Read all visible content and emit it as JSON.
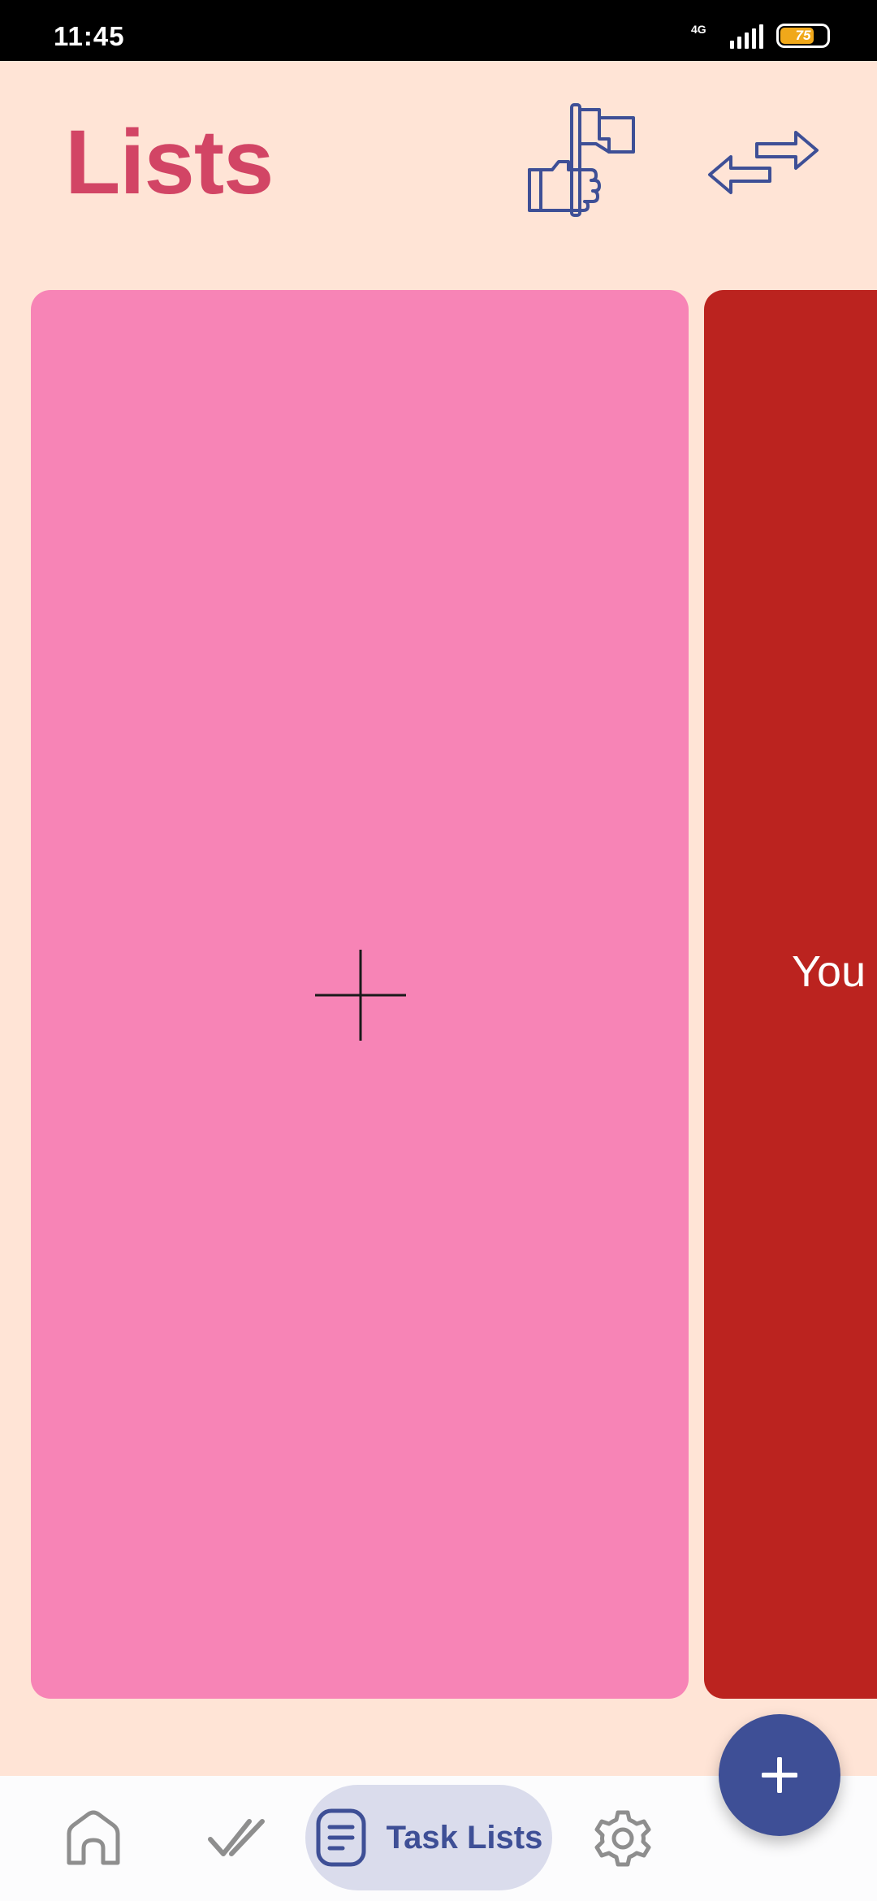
{
  "status_bar": {
    "time": "11:45",
    "network_type": "4G",
    "battery_level": "75",
    "battery_fraction": 0.75
  },
  "header": {
    "title": "Lists",
    "flag_icon": "hand-holding-flag-icon",
    "swap_icon": "swap-arrows-icon"
  },
  "cards": [
    {
      "type": "add",
      "icon": "plus-icon",
      "color": "#F784B6"
    },
    {
      "type": "list",
      "text": "You",
      "color": "#BB231F"
    }
  ],
  "bottom_nav": {
    "items": [
      {
        "icon": "home-icon",
        "label": "",
        "active": false
      },
      {
        "icon": "double-check-icon",
        "label": "",
        "active": false
      },
      {
        "icon": "document-icon",
        "label": "Task Lists",
        "active": true
      },
      {
        "icon": "gear-icon",
        "label": "",
        "active": false
      }
    ]
  },
  "fab": {
    "icon": "plus-icon"
  },
  "colors": {
    "background": "#FFE4D6",
    "title": "#D24565",
    "accent": "#3E4F96",
    "card_pink": "#F784B6",
    "card_red": "#BB231F",
    "nav_active_bg": "#DADCEC"
  }
}
